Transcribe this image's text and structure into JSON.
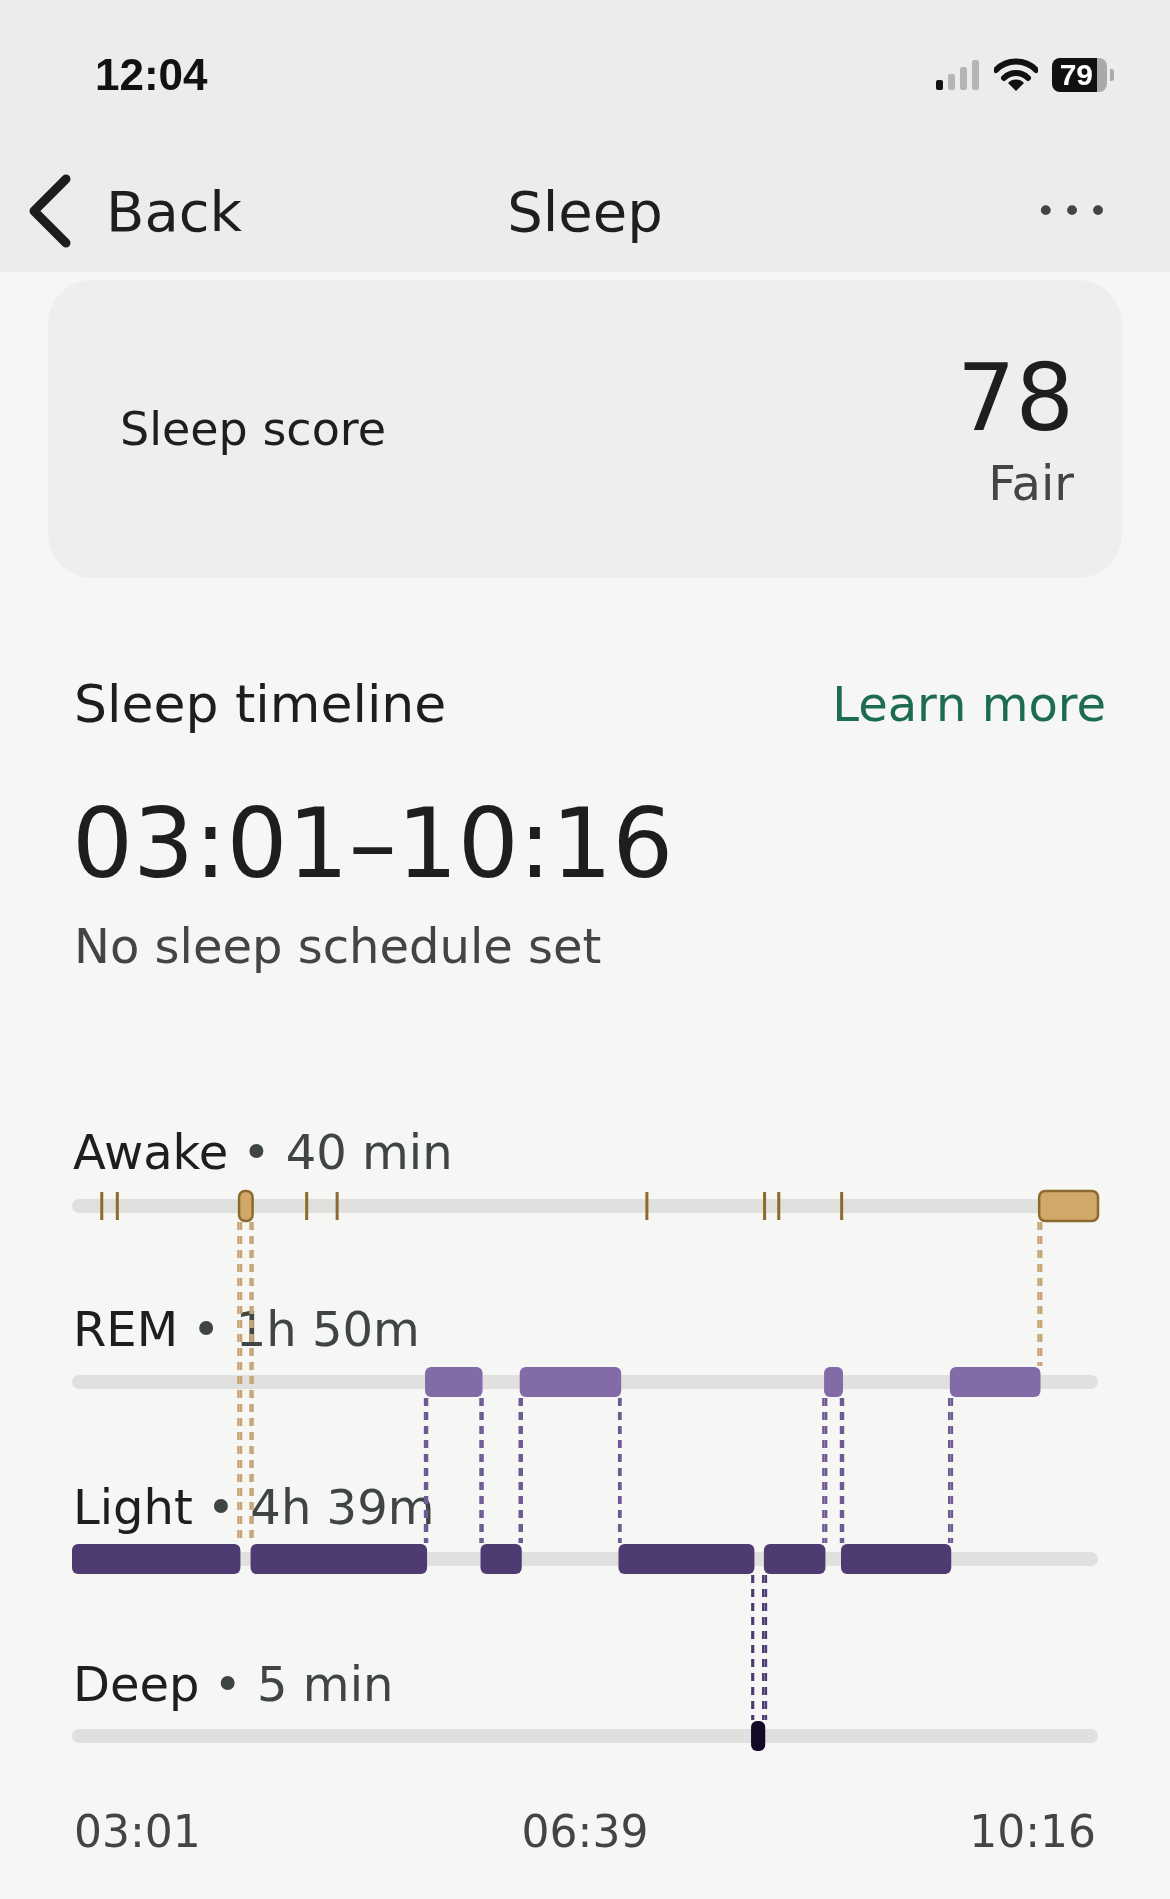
{
  "status_bar": {
    "time": "12:04",
    "battery": "79"
  },
  "nav": {
    "back": "Back",
    "title": "Sleep",
    "more": "•••"
  },
  "score_card": {
    "label": "Sleep score",
    "score": "78",
    "rating": "Fair"
  },
  "timeline": {
    "title": "Sleep timeline",
    "link": "Learn more",
    "range": "03:01–10:16",
    "schedule": "No sleep schedule set",
    "stages": [
      {
        "kind": "awake",
        "name": "Awake",
        "detail": "• 40 min"
      },
      {
        "kind": "rem",
        "name": "REM",
        "detail": "• 1h 50m"
      },
      {
        "kind": "light",
        "name": "Light",
        "detail": "• 4h 39m"
      },
      {
        "kind": "deep",
        "name": "Deep",
        "detail": "• 5 min"
      }
    ],
    "axis_labels": [
      "03:01",
      "06:39",
      "10:16"
    ]
  }
}
